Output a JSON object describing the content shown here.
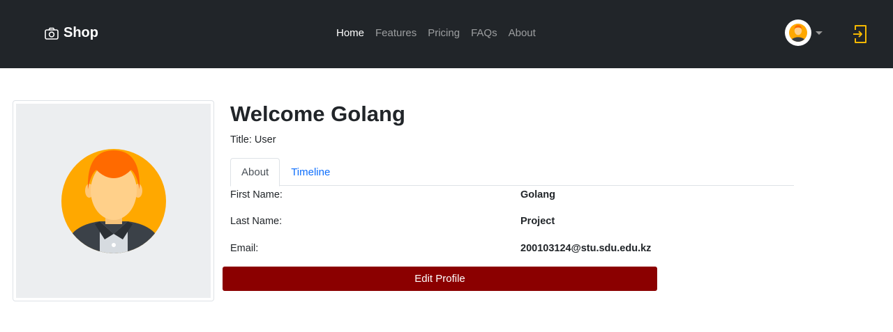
{
  "navbar": {
    "brand": "Shop",
    "links": [
      {
        "label": "Home",
        "active": true
      },
      {
        "label": "Features",
        "active": false
      },
      {
        "label": "Pricing",
        "active": false
      },
      {
        "label": "FAQs",
        "active": false
      },
      {
        "label": "About",
        "active": false
      }
    ],
    "logout_icon_color": "#f5b800"
  },
  "profile": {
    "welcome": "Welcome Golang",
    "title": "Title: User",
    "tabs": [
      {
        "label": "About",
        "active": true
      },
      {
        "label": "Timeline",
        "active": false
      }
    ],
    "fields": [
      {
        "label": "First Name:",
        "value": "Golang"
      },
      {
        "label": "Last Name:",
        "value": "Project"
      },
      {
        "label": "Email:",
        "value": "200103124@stu.sdu.edu.kz"
      }
    ],
    "edit_button": "Edit Profile"
  },
  "colors": {
    "navbar_bg": "#212529",
    "edit_button_bg": "#8b0000",
    "tab_link": "#0d6efd"
  }
}
